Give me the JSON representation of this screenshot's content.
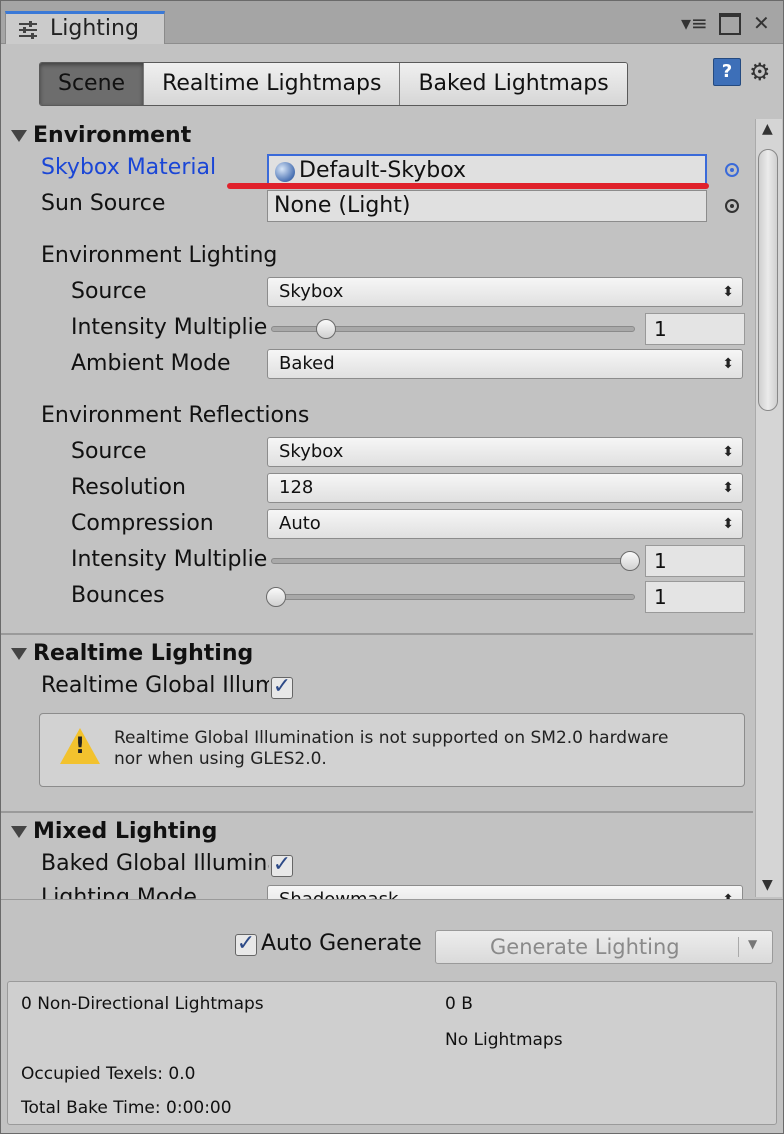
{
  "window": {
    "tab_title": "Lighting",
    "tab_icon": "lighting-sliders-icon",
    "controls": [
      "menu-icon",
      "maximize-icon",
      "close-icon"
    ],
    "close_label": "✕"
  },
  "toolbar": {
    "tabs": [
      "Scene",
      "Realtime Lightmaps",
      "Baked Lightmaps"
    ],
    "active_tab": "Scene"
  },
  "environment": {
    "header": "Environment",
    "skybox_label": "Skybox Material",
    "skybox_value": "Default-Skybox",
    "sun_label": "Sun Source",
    "sun_value": "None (Light)",
    "lighting_header": "Environment Lighting",
    "lighting": {
      "source_label": "Source",
      "source_value": "Skybox",
      "intensity_label": "Intensity Multiplier",
      "intensity_value": "1",
      "intensity_level": 0.14,
      "ambient_label": "Ambient Mode",
      "ambient_value": "Baked"
    },
    "reflections_header": "Environment Reflections",
    "reflections": {
      "source_label": "Source",
      "source_value": "Skybox",
      "resolution_label": "Resolution",
      "resolution_value": "128",
      "compression_label": "Compression",
      "compression_value": "Auto",
      "intensity_label": "Intensity Multiplier",
      "intensity_value": "1",
      "intensity_level": 1.0,
      "bounces_label": "Bounces",
      "bounces_value": "1",
      "bounces_level": 0.0
    }
  },
  "realtime": {
    "header": "Realtime Lighting",
    "gi_label": "Realtime Global Illumination",
    "gi_checked": true,
    "warning_line1": "Realtime Global Illumination is not supported on SM2.0 hardware",
    "warning_line2": "nor when using GLES2.0."
  },
  "mixed": {
    "header": "Mixed Lighting",
    "baked_gi_label": "Baked Global Illumination",
    "baked_gi_checked": true,
    "mode_label": "Lighting Mode",
    "mode_value": "Shadowmask"
  },
  "footer": {
    "auto_generate_label": "Auto Generate",
    "auto_generate_checked": true,
    "generate_button": "Generate Lighting"
  },
  "stats": {
    "lightmaps": "0 Non-Directional Lightmaps",
    "size": "0 B",
    "no_lightmaps": "No Lightmaps",
    "occupied": "Occupied Texels: 0.0",
    "bake_time": "Total Bake Time: 0:00:00"
  },
  "colors": {
    "selected_label": "#1a46d6",
    "annotation_underline": "#e0212b",
    "warning": "#f2c22e"
  }
}
